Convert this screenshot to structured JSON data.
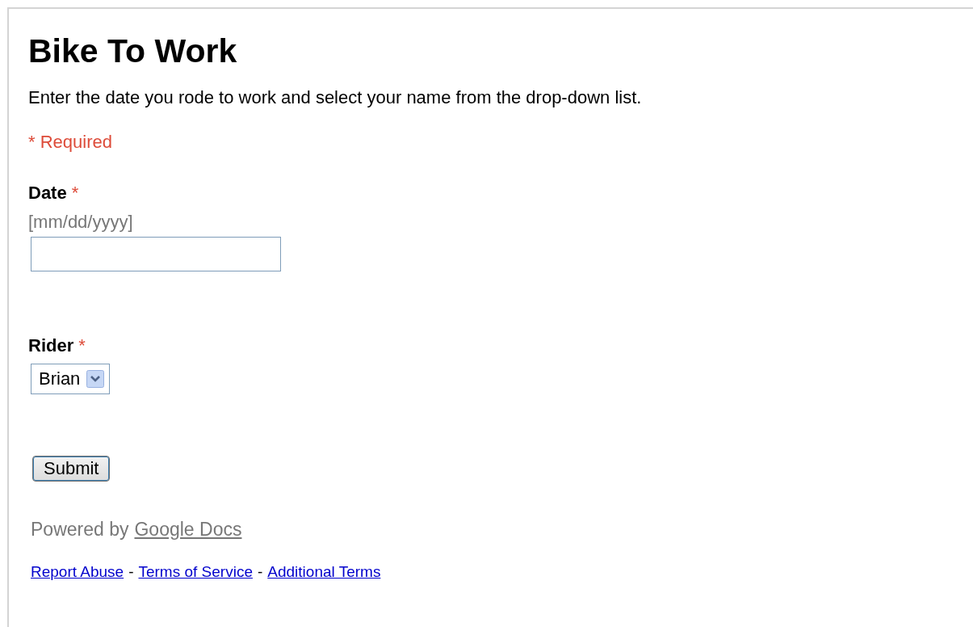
{
  "title": "Bike To Work",
  "description": "Enter the date you rode to work and select your name from the drop-down list.",
  "required_note": "* Required",
  "fields": [
    {
      "kind": "text",
      "label": "Date",
      "required_mark": "*",
      "help_text": "[mm/dd/yyyy]"
    },
    {
      "kind": "select",
      "label": "Rider",
      "required_mark": "*",
      "value": "Brian"
    }
  ],
  "submit": "Submit",
  "powered_by": {
    "text": "Powered by",
    "link": "Google Docs"
  },
  "footer": [
    {
      "kind": "link",
      "text": "Report Abuse"
    },
    {
      "kind": "separator",
      "text": "-"
    },
    {
      "kind": "link",
      "text": "Terms of Service"
    },
    {
      "kind": "separator",
      "text": "-"
    },
    {
      "kind": "link",
      "text": "Additional Terms"
    }
  ]
}
